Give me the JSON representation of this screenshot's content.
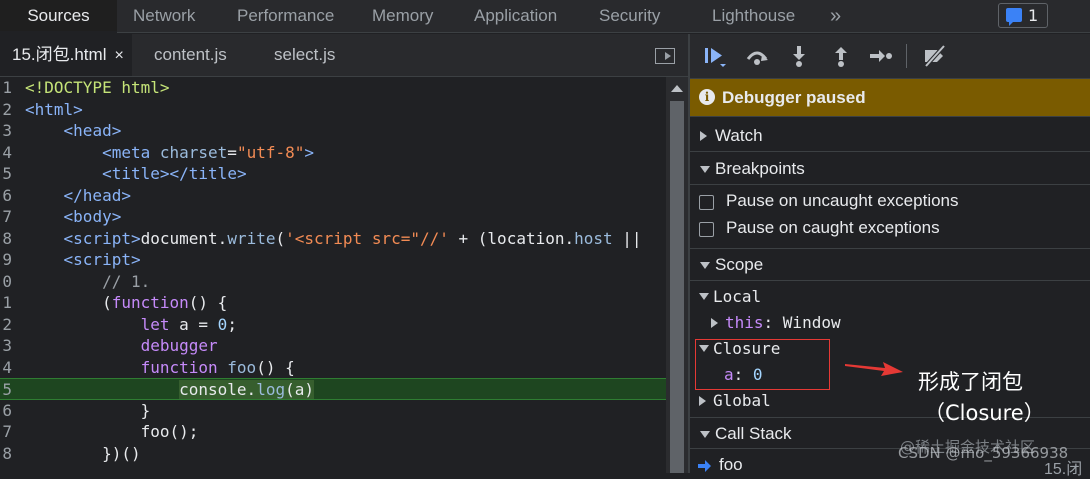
{
  "top_tabs": [
    "Sources",
    "Network",
    "Performance",
    "Memory",
    "Application",
    "Security",
    "Lighthouse"
  ],
  "top_more": "»",
  "messages": {
    "count": "1"
  },
  "file_tabs": [
    {
      "label": "15.闭包.html",
      "close": "×"
    },
    {
      "label": "content.js"
    },
    {
      "label": "select.js"
    }
  ],
  "code_lines": [
    {
      "n": "1"
    },
    {
      "n": "2"
    },
    {
      "n": "3"
    },
    {
      "n": "4"
    },
    {
      "n": "5"
    },
    {
      "n": "6"
    },
    {
      "n": "7"
    },
    {
      "n": "8"
    },
    {
      "n": "9"
    },
    {
      "n": "0"
    },
    {
      "n": "1"
    },
    {
      "n": "2"
    },
    {
      "n": "3"
    },
    {
      "n": "4"
    },
    {
      "n": "5"
    },
    {
      "n": "6"
    },
    {
      "n": "7"
    },
    {
      "n": "8"
    }
  ],
  "code_tokens": {
    "l1": "<!DOCTYPE html>",
    "l2": "<html>",
    "l3a": "<",
    "l3b": "head",
    "l3c": ">",
    "l4a": "<",
    "l4b": "meta",
    "l4c": " charset",
    "l4d": "=",
    "l4e": "\"utf-8\"",
    "l4f": ">",
    "l5a": "<",
    "l5b": "title",
    "l5c": "></",
    "l5d": "title",
    "l5e": ">",
    "l6a": "</",
    "l6b": "head",
    "l6c": ">",
    "l7a": "<",
    "l7b": "body",
    "l7c": ">",
    "l8a": "<",
    "l8b": "script",
    "l8c": ">",
    "l8d": "document.",
    "l8e": "write",
    "l8f": "(",
    "l8g": "'<script src=\"//'",
    "l8h": " + (location.",
    "l8i": "host",
    "l8j": " ||",
    "l9a": "<",
    "l9b": "script",
    "l9c": ">",
    "l10": "// 1.",
    "l11a": "(",
    "l11b": "function",
    "l11c": "() {",
    "l12a": "let",
    "l12b": " a = ",
    "l12c": "0",
    "l12d": ";",
    "l13": "debugger",
    "l14a": "function",
    "l14b": " foo",
    "l14c": "() {",
    "l15a": "console.",
    "l15b": "log",
    "l15c": "(a)",
    "l16": "}",
    "l17": "foo();",
    "l18": "})()"
  },
  "debugger": {
    "paused_text": "Debugger paused",
    "watch": "Watch",
    "breakpoints": "Breakpoints",
    "pause_uncaught": "Pause on uncaught exceptions",
    "pause_caught": "Pause on caught exceptions",
    "scope": "Scope",
    "local": "Local",
    "this_key": "this",
    "this_val": "Window",
    "closure": "Closure",
    "closure_var": "a",
    "closure_val": "0",
    "global": "Global",
    "call_stack": "Call Stack",
    "frame_name": "foo",
    "frame_loc": "15.闭"
  },
  "annotation": {
    "line1": "形成了闭包",
    "line2": "（Closure）"
  },
  "watermark": {
    "w1": "@稀土掘金技术社区",
    "w2": "CSDN @mo_59366938"
  },
  "colors": {
    "accent": "#8ab4f8",
    "paused_bg": "#7a5b00",
    "exec_line": "#1e4620",
    "highlight_box": "#e53935"
  }
}
